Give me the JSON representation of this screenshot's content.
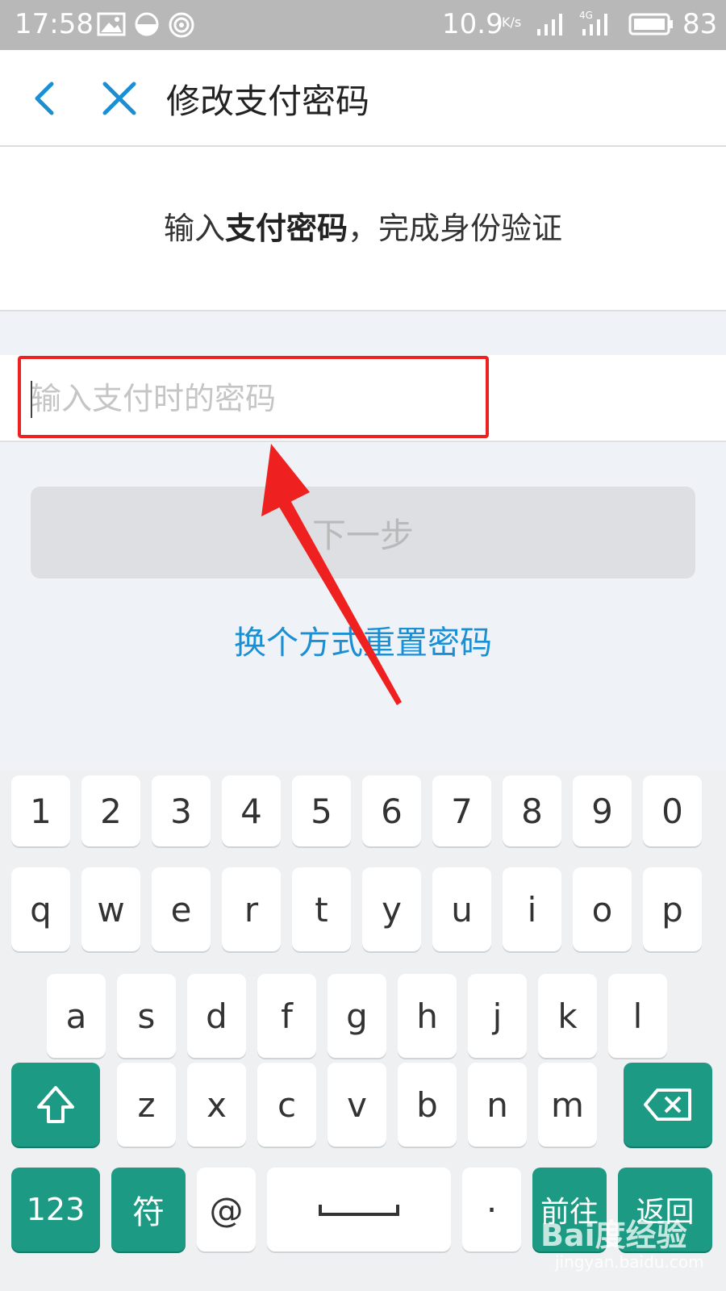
{
  "status_bar": {
    "time": "17:58",
    "net_speed": "10.9",
    "net_speed_unit": "K/s",
    "network_type": "4G",
    "battery": "83",
    "icons": [
      "image-icon",
      "pie-icon",
      "broadcast-icon",
      "signal-icon",
      "signal-4g-icon",
      "battery-icon"
    ]
  },
  "header": {
    "title": "修改支付密码"
  },
  "instruction": {
    "prefix": "输入",
    "emphasis": "支付密码",
    "suffix": "，完成身份验证"
  },
  "password_input": {
    "placeholder": "输入支付时的密码",
    "value": ""
  },
  "next_button": "下一步",
  "reset_link": "换个方式重置密码",
  "annotation": {
    "highlight_color": "#ee2020"
  },
  "keyboard": {
    "row1": [
      "1",
      "2",
      "3",
      "4",
      "5",
      "6",
      "7",
      "8",
      "9",
      "0"
    ],
    "row2": [
      "q",
      "w",
      "e",
      "r",
      "t",
      "y",
      "u",
      "i",
      "o",
      "p"
    ],
    "row3": [
      "a",
      "s",
      "d",
      "f",
      "g",
      "h",
      "j",
      "k",
      "l"
    ],
    "row4": [
      "z",
      "x",
      "c",
      "v",
      "b",
      "n",
      "m"
    ],
    "row5": {
      "numbers": "123",
      "symbols": "符",
      "at": "@",
      "dot": "·",
      "go": "前往",
      "back": "返回"
    },
    "accent_color": "#1c9a83"
  },
  "watermark": {
    "logo": "Bai度经验",
    "url": "jingyan.baidu.com"
  }
}
